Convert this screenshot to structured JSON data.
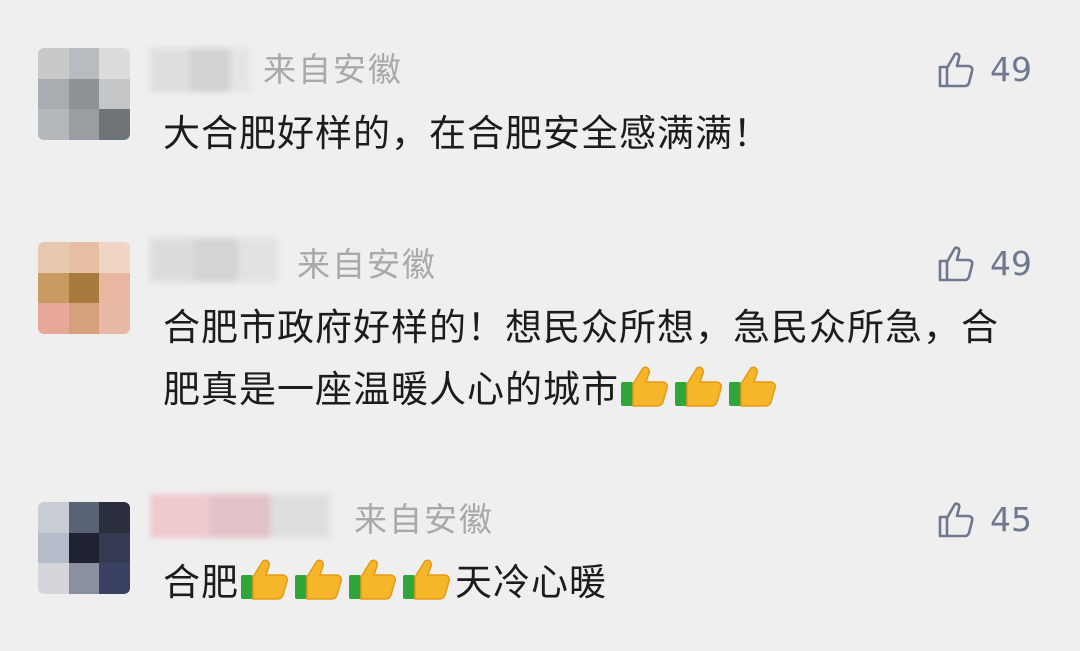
{
  "comments": [
    {
      "location": "来自安徽",
      "likes": "49",
      "text": "大合肥好样的，在合肥安全感满满！",
      "emojis": []
    },
    {
      "location": "来自安徽",
      "likes": "49",
      "text": "合肥市政府好样的！想民众所想，急民众所急，合肥真是一座温暖人心的城市",
      "emojis": [
        "thumbs-up-icon",
        "thumbs-up-icon",
        "thumbs-up-icon"
      ]
    },
    {
      "location": "来自安徽",
      "likes": "45",
      "text_before": "合肥",
      "text_after": "天冷心暖",
      "emojis": [
        "thumbs-up-icon",
        "thumbs-up-icon",
        "thumbs-up-icon",
        "thumbs-up-icon"
      ]
    }
  ],
  "colors": {
    "background": "#efefef",
    "location_text": "#a9a9a9",
    "like_icon": "#6f7890",
    "comment_text": "#1c1c1c"
  }
}
